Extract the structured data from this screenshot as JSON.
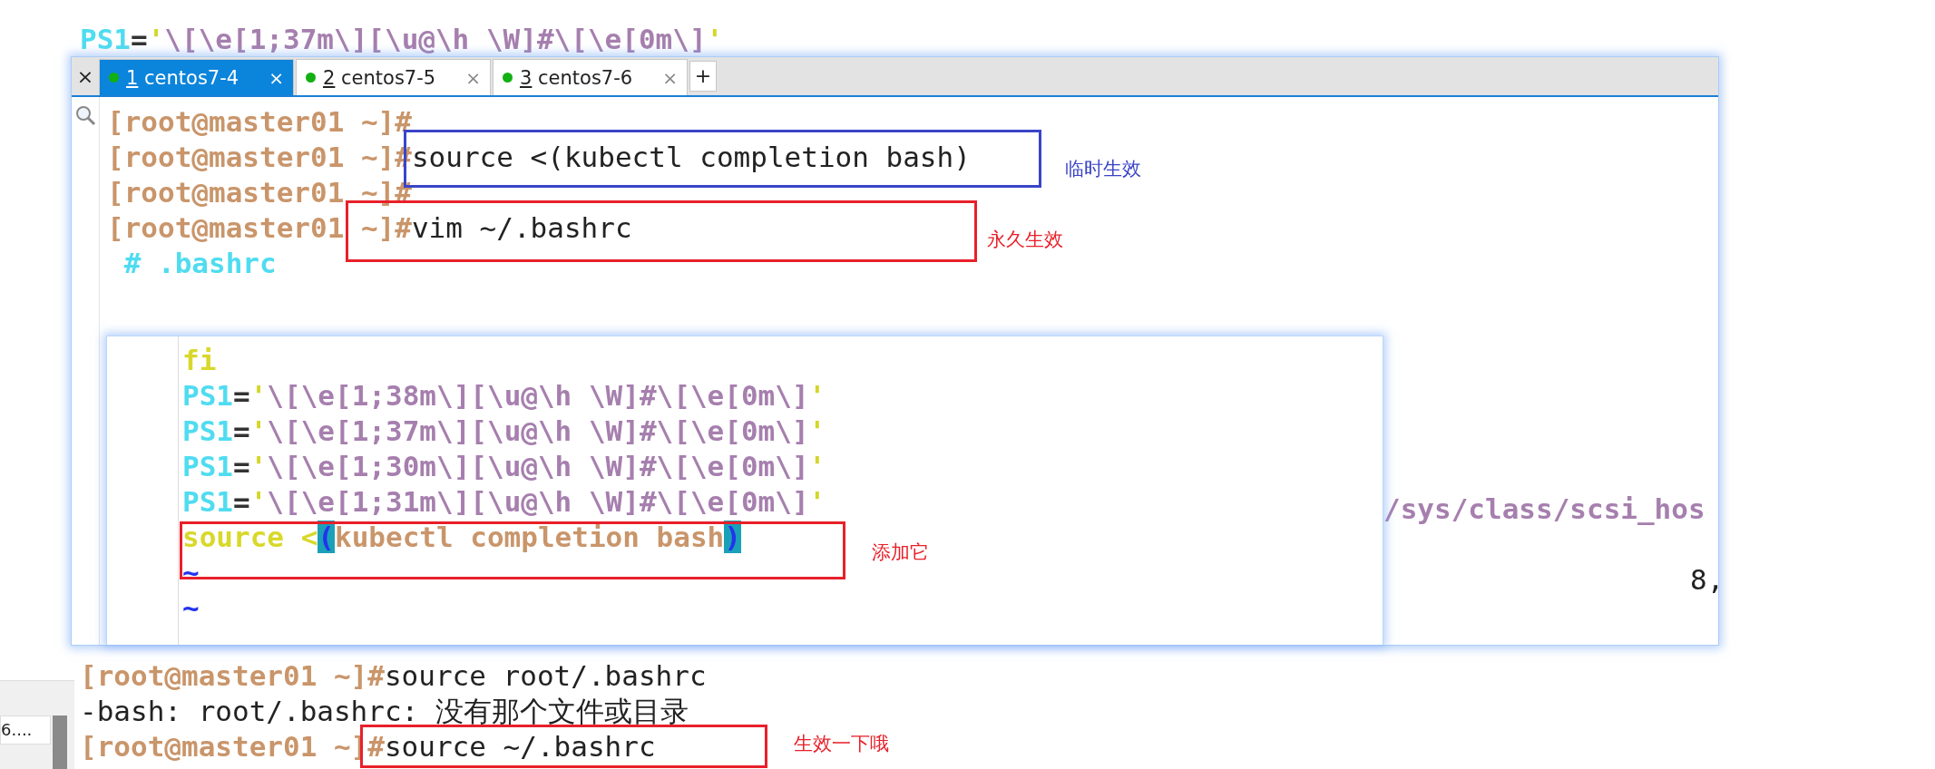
{
  "background_terminal": {
    "top_lines": [
      [
        {
          "kind": "var",
          "text": "PS1"
        },
        {
          "kind": "eq",
          "text": "="
        },
        {
          "kind": "quote",
          "text": "'"
        },
        {
          "kind": "str",
          "text": "\\[\\e[1;37m\\][\\u@\\h \\W]#\\[\\e[0m\\]"
        },
        {
          "kind": "quote",
          "text": "'"
        }
      ]
    ],
    "bottom_lines": [
      [
        {
          "kind": "prompt",
          "text": "[root@master01 ~]#"
        },
        {
          "kind": "cmd",
          "text": "source root/.bashrc"
        }
      ],
      [
        {
          "kind": "cmd",
          "text": "-bash: root/.bashrc: "
        },
        {
          "kind": "cn",
          "text": "没有那个文件或目录"
        }
      ],
      [
        {
          "kind": "prompt",
          "text": "[root@master01 ~]#"
        },
        {
          "kind": "cmd",
          "text": "source ~/.bashrc"
        }
      ]
    ]
  },
  "side_panel": {
    "item": "6...."
  },
  "terminal_window": {
    "close": "×",
    "new_tab": "+",
    "tabs": [
      {
        "number": "1",
        "label": "centos7-4",
        "close": "×",
        "selected": true,
        "color": "#13b013"
      },
      {
        "number": "2",
        "label": "centos7-5",
        "close": "×",
        "selected": false,
        "color": "#13b013"
      },
      {
        "number": "3",
        "label": "centos7-6",
        "close": "×",
        "selected": false,
        "color": "#13b013"
      }
    ],
    "lines": [
      [
        {
          "kind": "prompt",
          "text": "[root@master01 ~]#"
        }
      ],
      [
        {
          "kind": "prompt",
          "text": "[root@master01 ~]#"
        },
        {
          "kind": "cmd",
          "text": "source <(kubectl completion bash)"
        }
      ],
      [
        {
          "kind": "prompt",
          "text": "[root@master01 ~]#"
        }
      ],
      [
        {
          "kind": "prompt",
          "text": "[root@master01 ~]#"
        },
        {
          "kind": "cmd",
          "text": "vim ~/.bashrc"
        }
      ],
      [
        {
          "kind": "comment",
          "text": " # .bashrc"
        }
      ]
    ],
    "right_path": [
      {
        "kind": "str",
        "text": "/sys/class/scsi_hos"
      }
    ],
    "cursor_position": [
      {
        "kind": "cmd",
        "text": "8,"
      }
    ]
  },
  "vim_popup": {
    "lines": [
      [
        {
          "kind": "keyword",
          "text": "fi"
        }
      ],
      [
        {
          "kind": "var",
          "text": "PS1"
        },
        {
          "kind": "eq",
          "text": "="
        },
        {
          "kind": "quote",
          "text": "'"
        },
        {
          "kind": "str",
          "text": "\\[\\e[1;38m\\][\\u@\\h \\W]#\\[\\e[0m\\]"
        },
        {
          "kind": "quote",
          "text": "'"
        }
      ],
      [
        {
          "kind": "var",
          "text": "PS1"
        },
        {
          "kind": "eq",
          "text": "="
        },
        {
          "kind": "quote",
          "text": "'"
        },
        {
          "kind": "str",
          "text": "\\[\\e[1;37m\\][\\u@\\h \\W]#\\[\\e[0m\\]"
        },
        {
          "kind": "quote",
          "text": "'"
        }
      ],
      [
        {
          "kind": "var",
          "text": "PS1"
        },
        {
          "kind": "eq",
          "text": "="
        },
        {
          "kind": "quote",
          "text": "'"
        },
        {
          "kind": "str",
          "text": "\\[\\e[1;30m\\][\\u@\\h \\W]#\\[\\e[0m\\]"
        },
        {
          "kind": "quote",
          "text": "'"
        }
      ],
      [
        {
          "kind": "var",
          "text": "PS1"
        },
        {
          "kind": "eq",
          "text": "="
        },
        {
          "kind": "quote",
          "text": "'"
        },
        {
          "kind": "str",
          "text": "\\[\\e[1;31m\\][\\u@\\h \\W]#\\[\\e[0m\\]"
        },
        {
          "kind": "quote",
          "text": "'"
        }
      ],
      [
        {
          "kind": "keyword",
          "text": "source <"
        },
        {
          "kind": "paren",
          "text": "("
        },
        {
          "kind": "path",
          "text": "kubectl completion bash"
        },
        {
          "kind": "paren",
          "text": ")"
        }
      ],
      [
        {
          "kind": "tilde",
          "text": "~"
        }
      ],
      [
        {
          "kind": "tilde",
          "text": "~"
        }
      ]
    ]
  },
  "annotations": [
    {
      "text": "临时生效",
      "color": "#3a44c8"
    },
    {
      "text": "永久生效",
      "color": "#e8202a"
    },
    {
      "text": "添加它",
      "color": "#e8202a"
    },
    {
      "text": "生效一下哦",
      "color": "#e8202a"
    }
  ]
}
